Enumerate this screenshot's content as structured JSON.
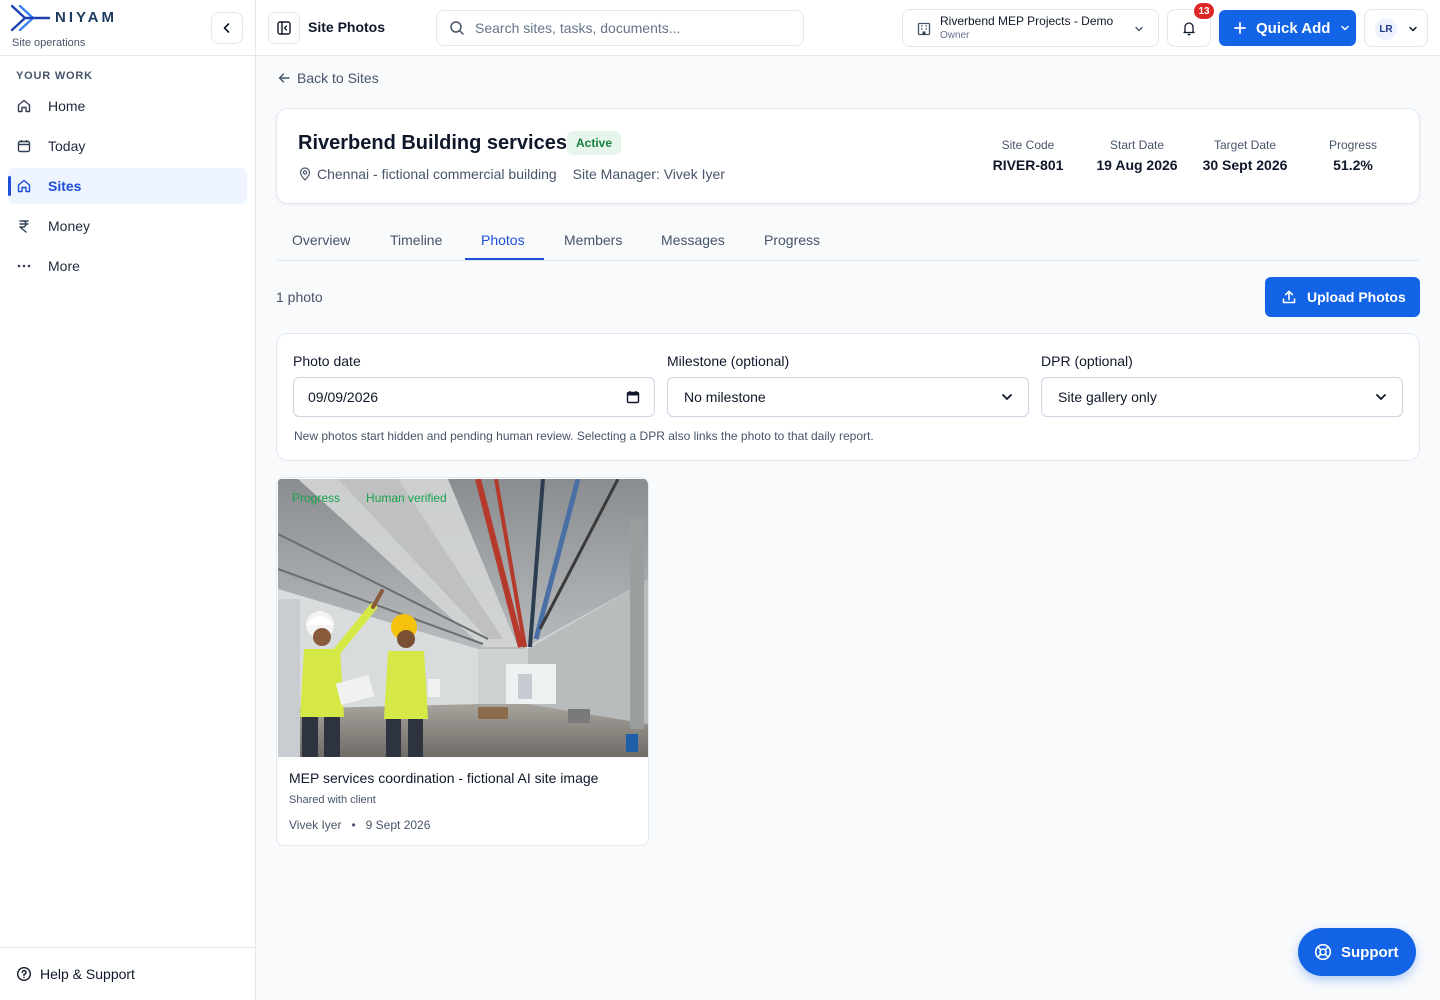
{
  "brand": {
    "name": "NIYAM",
    "subtitle": "Site operations"
  },
  "sidebar": {
    "section_label": "YOUR WORK",
    "items": [
      {
        "label": "Home",
        "icon": "home-icon",
        "active": false
      },
      {
        "label": "Today",
        "icon": "calendar-icon",
        "active": false
      },
      {
        "label": "Sites",
        "icon": "home-icon",
        "active": true
      },
      {
        "label": "Money",
        "icon": "rupee-icon",
        "active": false
      },
      {
        "label": "More",
        "icon": "ellipsis-icon",
        "active": false
      }
    ],
    "help_label": "Help & Support"
  },
  "header": {
    "page_title": "Site Photos",
    "search_placeholder": "Search sites, tasks, documents...",
    "project": {
      "name": "Riverbend MEP Projects - Demo",
      "role": "Owner"
    },
    "notification_count": "13",
    "quick_add_label": "Quick Add",
    "user_initials": "LR"
  },
  "back_label": "Back to Sites",
  "site": {
    "name": "Riverbend Building services",
    "status": "Active",
    "location": "Chennai - fictional commercial building",
    "manager": "Site Manager: Vivek Iyer",
    "stats": [
      {
        "label": "Site Code",
        "value": "RIVER-801"
      },
      {
        "label": "Start Date",
        "value": "19 Aug 2026"
      },
      {
        "label": "Target Date",
        "value": "30 Sept 2026"
      },
      {
        "label": "Progress",
        "value": "51.2%"
      }
    ]
  },
  "tabs": [
    "Overview",
    "Timeline",
    "Photos",
    "Members",
    "Messages",
    "Progress"
  ],
  "active_tab": "Photos",
  "photos_toolbar": {
    "count_label": "1 photo",
    "upload_label": "Upload Photos"
  },
  "filters": {
    "date": {
      "label": "Photo date",
      "value": "09/09/2026"
    },
    "milestone": {
      "label": "Milestone (optional)",
      "value": "No milestone"
    },
    "dpr": {
      "label": "DPR (optional)",
      "value": "Site gallery only"
    },
    "note": "New photos start hidden and pending human review. Selecting a DPR also links the photo to that daily report."
  },
  "photos": [
    {
      "tags": [
        "Progress",
        "Human verified"
      ],
      "title": "MEP services coordination - fictional AI site image",
      "sharing": "Shared with client",
      "author": "Vivek Iyer",
      "date": "9 Sept 2026"
    }
  ],
  "support_label": "Support",
  "colors": {
    "accent": "#1263e6",
    "active_nav_bg": "#eef4ff",
    "status_green": "#15803d",
    "badge_red": "#dc2626"
  }
}
